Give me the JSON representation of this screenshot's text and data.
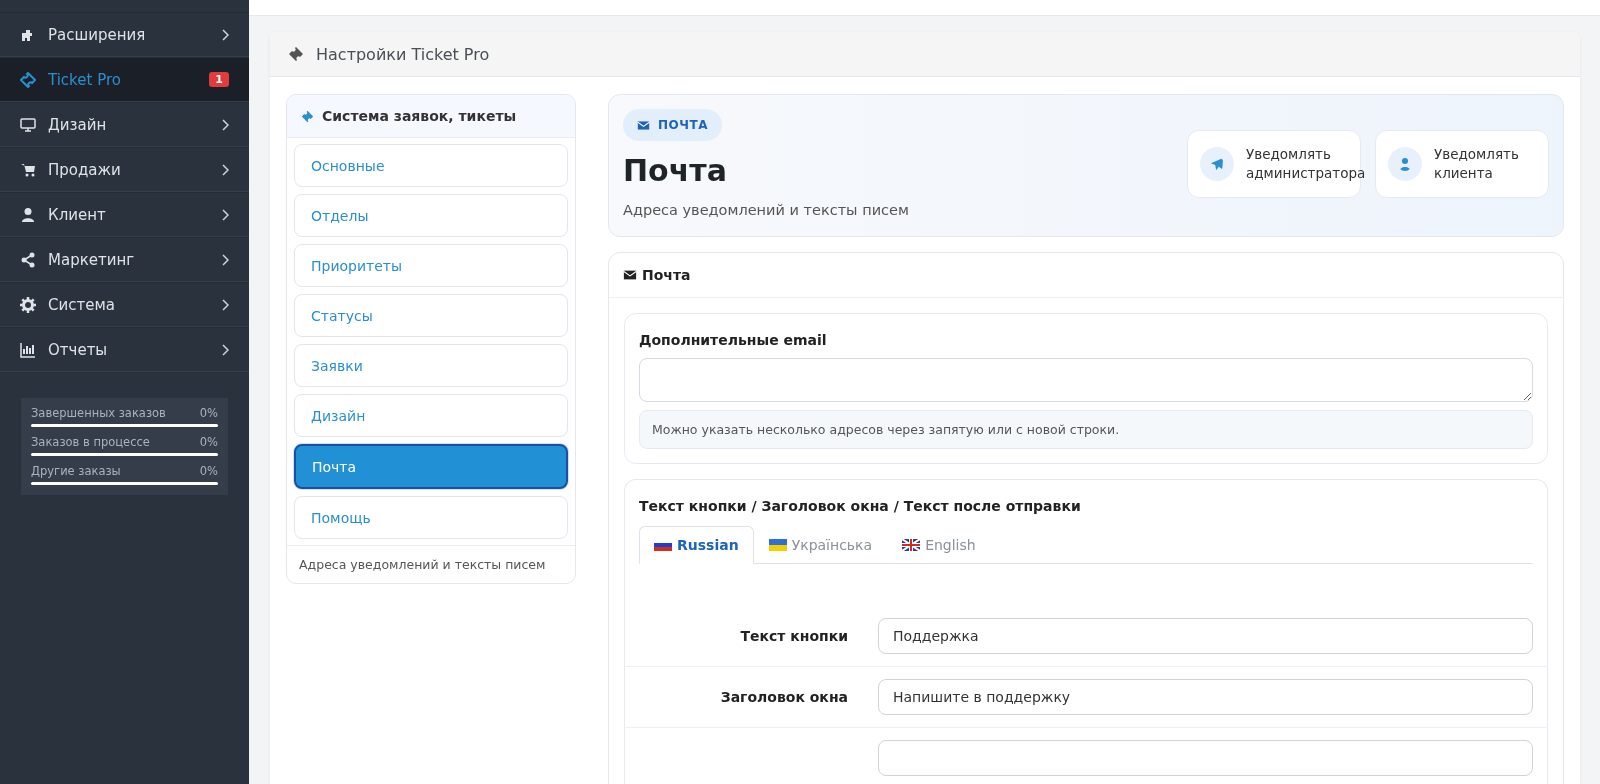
{
  "sidebar": {
    "items": [
      {
        "label": "Расширения",
        "selected": false
      },
      {
        "label": "Ticket Pro",
        "selected": true,
        "badge": "1"
      },
      {
        "label": "Дизайн",
        "selected": false
      },
      {
        "label": "Продажи",
        "selected": false
      },
      {
        "label": "Клиент",
        "selected": false
      },
      {
        "label": "Маркетинг",
        "selected": false
      },
      {
        "label": "Система",
        "selected": false
      },
      {
        "label": "Отчеты",
        "selected": false
      }
    ],
    "stats": [
      {
        "label": "Завершенных заказов",
        "value": "0%",
        "level": 0
      },
      {
        "label": "Заказов в процессе",
        "value": "0%",
        "level": 0
      },
      {
        "label": "Другие заказы",
        "value": "0%",
        "level": 0
      }
    ]
  },
  "page": {
    "title": "Настройки Ticket Pro"
  },
  "nav": {
    "title": "Система заявок, тикеты",
    "items": [
      {
        "label": "Основные",
        "selected": false
      },
      {
        "label": "Отделы",
        "selected": false
      },
      {
        "label": "Приоритеты",
        "selected": false
      },
      {
        "label": "Статусы",
        "selected": false
      },
      {
        "label": "Заявки",
        "selected": false
      },
      {
        "label": "Дизайн",
        "selected": false
      },
      {
        "label": "Почта",
        "selected": true
      },
      {
        "label": "Помощь",
        "selected": false
      }
    ],
    "footer": "Адреса уведомлений и тексты писем"
  },
  "hero": {
    "badge": "ПОЧТА",
    "title": "Почта",
    "subtitle": "Адреса уведомлений и тексты писем",
    "actions": [
      {
        "label": "Уведомлять администратора"
      },
      {
        "label": "Уведомлять клиента"
      }
    ]
  },
  "section": {
    "title": "Почта",
    "emails": {
      "label": "Дополнительные email",
      "hint": "Можно указать несколько адресов через запятую или с новой строки."
    },
    "texts": {
      "title": "Текст кнопки / Заголовок окна / Текст после отправки",
      "tabs": [
        {
          "label": "Russian",
          "selected": true
        },
        {
          "label": "Українська",
          "selected": false
        },
        {
          "label": "English",
          "selected": false
        }
      ],
      "fields": [
        {
          "label": "Текст кнопки",
          "value": "Поддержка"
        },
        {
          "label": "Заголовок окна",
          "value": "Напишите в поддержку"
        }
      ]
    }
  }
}
